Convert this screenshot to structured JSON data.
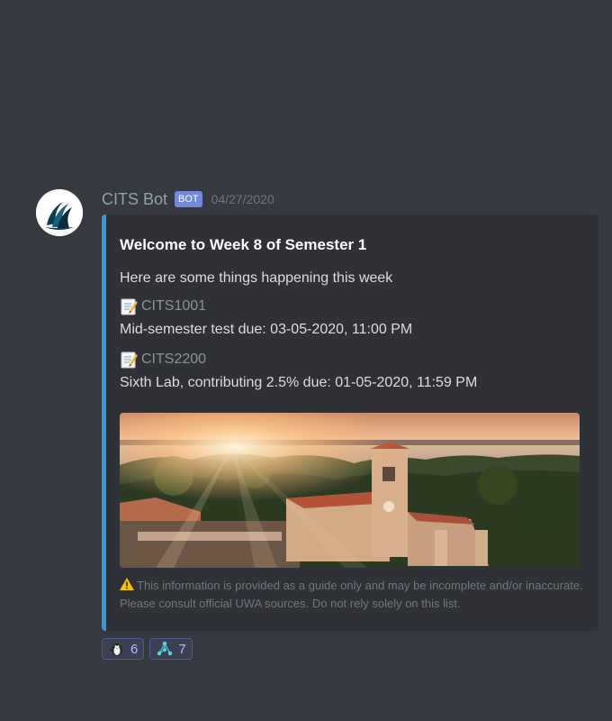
{
  "message": {
    "username": "CITS Bot",
    "bot_tag": "BOT",
    "timestamp": "04/27/2020",
    "embed": {
      "title": "Welcome to Week 8 of Semester 1",
      "description": "Here are some things happening this week",
      "items": [
        {
          "icon": "memo-icon",
          "code": "CITS1001",
          "detail": "Mid-semester test due: 03-05-2020, 11:00 PM"
        },
        {
          "icon": "memo-icon",
          "code": "CITS2200",
          "detail": "Sixth Lab, contributing 2.5% due: 01-05-2020, 11:59 PM"
        }
      ],
      "image": "campus-sunset-photo",
      "footer_icon": "warning-icon",
      "footer": "This information is provided as a guide only and may be incomplete and/or inaccurate. Please consult official UWA sources. Do not rely solely on this list.",
      "accent_color": "#3498db"
    },
    "reactions": [
      {
        "icon": "penguin-emoji",
        "count": "6"
      },
      {
        "icon": "network-emoji",
        "count": "7"
      }
    ]
  }
}
